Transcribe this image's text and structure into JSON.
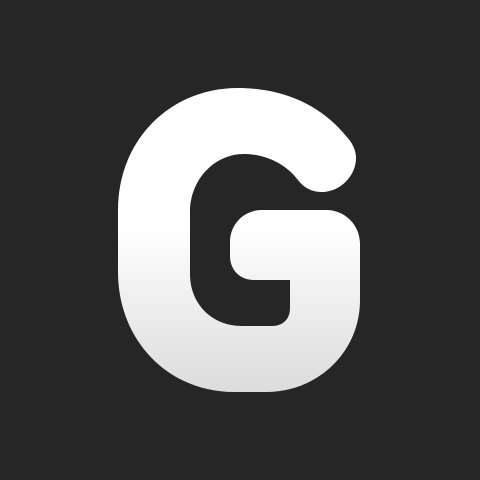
{
  "icon": {
    "name": "G app icon",
    "glyph": "G",
    "colors": {
      "background": "#262626",
      "glyph_top": "#ffffff",
      "glyph_bottom": "#dcdcdc"
    }
  }
}
